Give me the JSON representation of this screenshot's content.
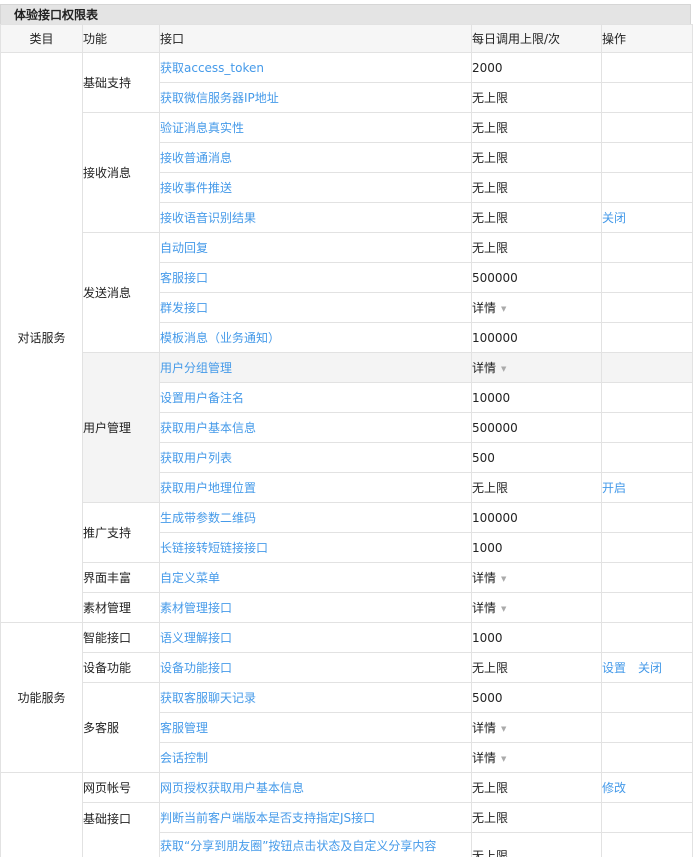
{
  "table_title": "体验接口权限表",
  "headers": {
    "category": "类目",
    "function": "功能",
    "api": "接口",
    "limit": "每日调用上限/次",
    "operation": "操作"
  },
  "categories": {
    "conversation": "对话服务",
    "feature": "功能服务"
  },
  "groups": {
    "basic_support": "基础支持",
    "receive_msg": "接收消息",
    "send_msg": "发送消息",
    "user_mgmt": "用户管理",
    "promotion": "推广支持",
    "ui_rich": "界面丰富",
    "material_mgmt": "素材管理",
    "smart_api": "智能接口",
    "device": "设备功能",
    "multi_cs": "多客服",
    "web_account": "网页帐号",
    "basic_api": "基础接口"
  },
  "rows": [
    {
      "api": "获取access_token",
      "limit": "2000"
    },
    {
      "api": "获取微信服务器IP地址",
      "limit": "无上限"
    },
    {
      "api": "验证消息真实性",
      "limit": "无上限"
    },
    {
      "api": "接收普通消息",
      "limit": "无上限"
    },
    {
      "api": "接收事件推送",
      "limit": "无上限"
    },
    {
      "api": "接收语音识别结果",
      "limit": "无上限",
      "op1": "关闭"
    },
    {
      "api": "自动回复",
      "limit": "无上限"
    },
    {
      "api": "客服接口",
      "limit": "500000"
    },
    {
      "api": "群发接口",
      "limit": "详情"
    },
    {
      "api": "模板消息（业务通知）",
      "limit": "100000"
    },
    {
      "api": "用户分组管理",
      "limit": "详情"
    },
    {
      "api": "设置用户备注名",
      "limit": "10000"
    },
    {
      "api": "获取用户基本信息",
      "limit": "500000"
    },
    {
      "api": "获取用户列表",
      "limit": "500"
    },
    {
      "api": "获取用户地理位置",
      "limit": "无上限",
      "op1": "开启"
    },
    {
      "api": "生成带参数二维码",
      "limit": "100000"
    },
    {
      "api": "长链接转短链接接口",
      "limit": "1000"
    },
    {
      "api": "自定义菜单",
      "limit": "详情"
    },
    {
      "api": "素材管理接口",
      "limit": "详情"
    },
    {
      "api": "语义理解接口",
      "limit": "1000"
    },
    {
      "api": "设备功能接口",
      "limit": "无上限",
      "op1": "设置",
      "op2": "关闭"
    },
    {
      "api": "获取客服聊天记录",
      "limit": "5000"
    },
    {
      "api": "客服管理",
      "limit": "详情"
    },
    {
      "api": "会话控制",
      "limit": "详情"
    },
    {
      "api": "网页授权获取用户基本信息",
      "limit": "无上限",
      "op1": "修改"
    },
    {
      "api": "判断当前客户端版本是否支持指定JS接口",
      "limit": "无上限"
    },
    {
      "api": "获取“分享到朋友圈”按钮点击状态及自定义分享内容",
      "limit": "无上限"
    }
  ],
  "colors": {
    "link": "#459ae9",
    "header_bg": "#f6f6f6",
    "title_bg": "#e4e4e4",
    "highlight_bg": "#f4f4f4",
    "border": "#e2e2e2"
  },
  "icons": {
    "dropdown": "caret-down-icon"
  }
}
